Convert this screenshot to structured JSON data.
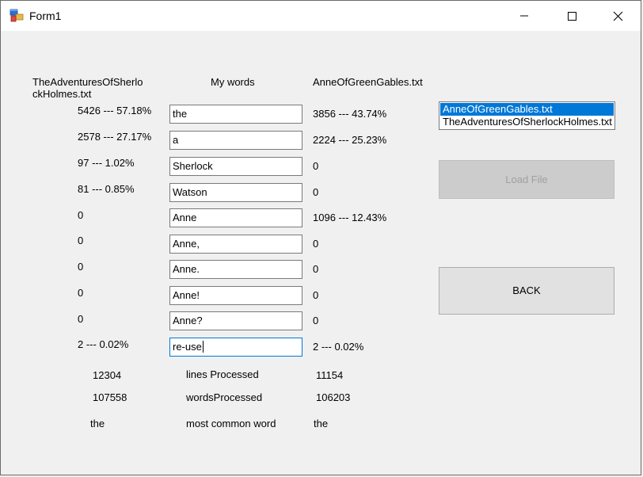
{
  "window": {
    "title": "Form1"
  },
  "headers": {
    "left_file": "TheAdventuresOfSherlockHolmes.txt",
    "my_words": "My words",
    "right_file": "AnneOfGreenGables.txt"
  },
  "rows": [
    {
      "left": "5426 --- 57.18%",
      "word": "the",
      "right": "3856 --- 43.74%"
    },
    {
      "left": "2578 --- 27.17%",
      "word": "a",
      "right": "2224 --- 25.23%"
    },
    {
      "left": "97 --- 1.02%",
      "word": "Sherlock",
      "right": "0"
    },
    {
      "left": "81 --- 0.85%",
      "word": "Watson",
      "right": "0"
    },
    {
      "left": "0",
      "word": "Anne",
      "right": "1096 --- 12.43%"
    },
    {
      "left": "0",
      "word": "Anne,",
      "right": "0"
    },
    {
      "left": "0",
      "word": "Anne.",
      "right": "0"
    },
    {
      "left": "0",
      "word": "Anne!",
      "right": "0"
    },
    {
      "left": "0",
      "word": "Anne?",
      "right": "0"
    },
    {
      "left": "2 --- 0.02%",
      "word": "re-use",
      "right": "2 --- 0.02%"
    }
  ],
  "stats": {
    "lines_left": "12304",
    "lines_label": "lines Processed",
    "lines_right": "11154",
    "words_left": "107558",
    "words_label": "wordsProcessed",
    "words_right": "106203",
    "common_left": "the",
    "common_label": "most common word",
    "common_right": "the"
  },
  "file_list": {
    "items": [
      "AnneOfGreenGables.txt",
      "TheAdventuresOfSherlockHolmes.txt"
    ],
    "selected": "AnneOfGreenGables.txt"
  },
  "buttons": {
    "load_file": "Load File",
    "back": "BACK"
  },
  "icons": {
    "app": "winforms-app-icon",
    "minimize": "minimize-icon",
    "maximize": "maximize-icon",
    "close": "close-icon"
  },
  "colors": {
    "selection": "#0078d7",
    "focus_border": "#0078d7"
  }
}
